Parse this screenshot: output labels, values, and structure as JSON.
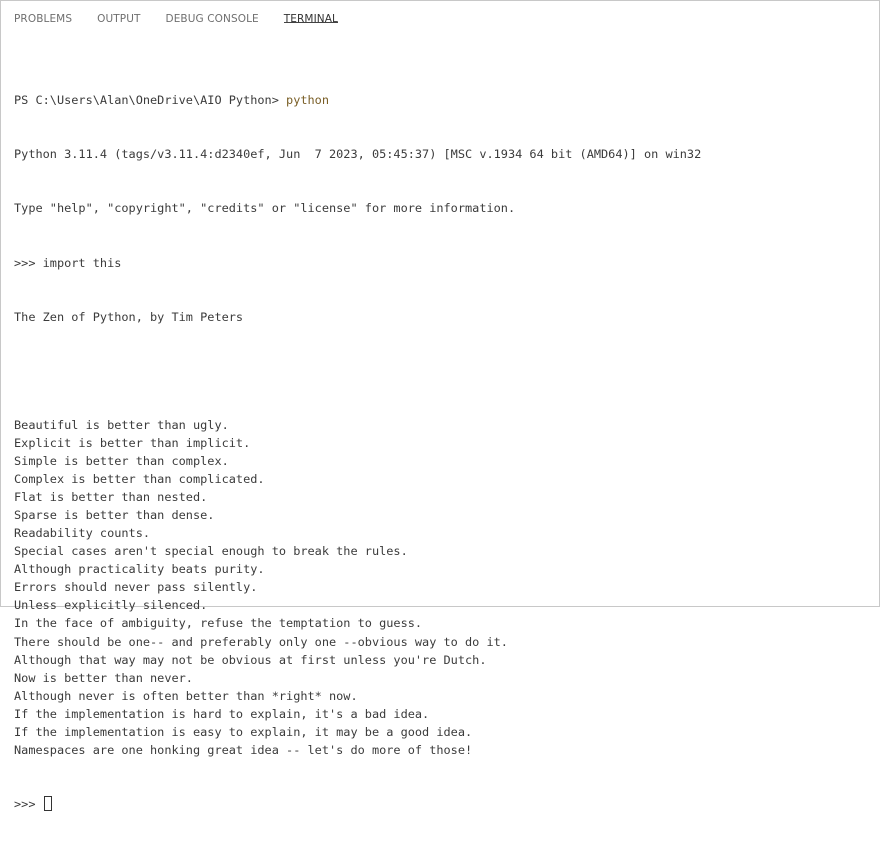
{
  "panel": {
    "tabs": [
      {
        "label": "PROBLEMS"
      },
      {
        "label": "OUTPUT"
      },
      {
        "label": "DEBUG CONSOLE"
      },
      {
        "label": "TERMINAL"
      }
    ],
    "active_tab": "TERMINAL"
  },
  "terminal": {
    "prompt": "PS C:\\Users\\Alan\\OneDrive\\AIO Python> ",
    "command": "python",
    "banner": [
      "Python 3.11.4 (tags/v3.11.4:d2340ef, Jun  7 2023, 05:45:37) [MSC v.1934 64 bit (AMD64)] on win32",
      "Type \"help\", \"copyright\", \"credits\" or \"license\" for more information."
    ],
    "repl_prompt": ">>> ",
    "repl_command": "import this",
    "zen_title": "The Zen of Python, by Tim Peters",
    "zen_lines": [
      "Beautiful is better than ugly.",
      "Explicit is better than implicit.",
      "Simple is better than complex.",
      "Complex is better than complicated.",
      "Flat is better than nested.",
      "Sparse is better than dense.",
      "Readability counts.",
      "Special cases aren't special enough to break the rules.",
      "Although practicality beats purity.",
      "Errors should never pass silently.",
      "Unless explicitly silenced.",
      "In the face of ambiguity, refuse the temptation to guess.",
      "There should be one-- and preferably only one --obvious way to do it.",
      "Although that way may not be obvious at first unless you're Dutch.",
      "Now is better than never.",
      "Although never is often better than *right* now.",
      "If the implementation is hard to explain, it's a bad idea.",
      "If the implementation is easy to explain, it may be a good idea.",
      "Namespaces are one honking great idea -- let's do more of those!"
    ],
    "final_prompt": ">>> "
  },
  "colors": {
    "command_text": "#795e26",
    "output_text": "#3b3b3b",
    "active_tab_underline": "#424242"
  }
}
